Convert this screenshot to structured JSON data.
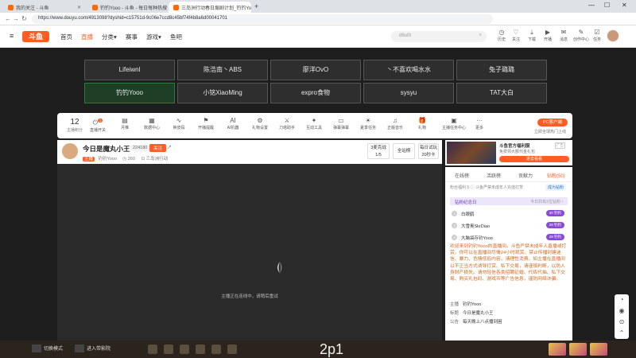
{
  "browser": {
    "tabs": [
      {
        "label": "我的关注 - 斗鱼"
      },
      {
        "label": "钓钓Yooo - 斗鱼 - 每日每种热搜"
      },
      {
        "label": "三岛洲行动春日煽剧计划_钓钓Yo"
      }
    ],
    "new_tab": "+",
    "win_min": "—",
    "win_max": "☐",
    "win_close": "✕",
    "back": "←",
    "forward": "→",
    "reload": "↻",
    "url": "https://www.douyu.com/4913098?dyshid=c15751d-9c06e7ccd8c45bf74f4b8a6d00041701"
  },
  "header": {
    "menu_icon": "≡",
    "logo": "斗鱼",
    "nav": [
      "首页",
      "直播",
      "分类",
      "赛事",
      "游戏",
      "鱼吧"
    ],
    "search_placeholder": "d8u0t",
    "icons": [
      {
        "label": "历史",
        "glyph": "◷"
      },
      {
        "label": "关注",
        "glyph": "♡"
      },
      {
        "label": "下载",
        "glyph": "⤓"
      },
      {
        "label": "开播",
        "glyph": "▶"
      },
      {
        "label": "消息",
        "glyph": "✉"
      },
      {
        "label": "创作中心",
        "glyph": "✎"
      },
      {
        "label": "任务",
        "glyph": "☑"
      }
    ]
  },
  "grid": {
    "row1": [
      "Lifeiwnl",
      "陈浩南丶ABS",
      "廖洋OvO",
      "丶不喜欢喝水水",
      "兔子璐璐"
    ],
    "row2": [
      "钓钓Yooo",
      "小铭XiaoMing",
      "expro食物",
      "sysyu",
      "TAT大白"
    ]
  },
  "toolbar": {
    "level_num": "12",
    "level_label": "主播积分",
    "tools": [
      {
        "label": "直播开关",
        "glyph": "⏻",
        "badge": "1"
      },
      {
        "label": "月推",
        "glyph": "▤"
      },
      {
        "label": "数据中心",
        "glyph": "▦"
      },
      {
        "label": "换皮码",
        "glyph": "∿"
      },
      {
        "label": "开播提醒",
        "glyph": "⚑"
      },
      {
        "label": "AI机器",
        "glyph": "AI"
      },
      {
        "label": "礼物设置",
        "glyph": "⚙"
      },
      {
        "label": "刀塔助手",
        "glyph": "⚔"
      },
      {
        "label": "互动工具",
        "glyph": "✦"
      },
      {
        "label": "弹幕弹幕",
        "glyph": "▭"
      },
      {
        "label": "夏季任务",
        "glyph": "☀"
      },
      {
        "label": "正版音乐",
        "glyph": "♫"
      },
      {
        "label": "礼物",
        "glyph": "🎁"
      },
      {
        "label": "主播任务中心",
        "glyph": "▣"
      },
      {
        "label": "更多",
        "glyph": "···"
      }
    ],
    "pc_label": "PC客户端",
    "pc_sub": "立即全球热门上线"
  },
  "streamer": {
    "title": "今日是魔丸小王",
    "follow_count": "224180",
    "follow_label": "关注",
    "share": "↗",
    "level_badge": "主播",
    "name": "钓钓Yooo",
    "online": "◷ 260",
    "category": "⊡ 三岛洲行动",
    "box1_top": "3麦克战",
    "box1_bottom": "1/5",
    "box2": "全站榜",
    "box3_top": "每日试玩",
    "box3_bottom": "20秒卡"
  },
  "video": {
    "status": "主播正在连线中，请稍后重试"
  },
  "ad": {
    "title": "斗鱼官方福利服",
    "sub": "免费领大额代金礼包",
    "button": "进去看看",
    "tag": "广告"
  },
  "panel": {
    "tabs": [
      "在线榜",
      "活跃榜",
      "贡献力",
      "钻粉(50)"
    ],
    "active_tab": 3,
    "row2": "粉丝福利 5 ⓘ 斗鱼严禁未成年人充值打赏",
    "row2_btn": "成为钻粉",
    "fan_header": "钻粉纪念日",
    "fan_header_right": "今日共有2位钻粉 ›",
    "fans": [
      {
        "rank": "1",
        "name": "白眼鹤",
        "badge": "30 钓钓"
      },
      {
        "rank": "2",
        "name": "大雪奥SkrDiao",
        "badge": "28 钓钓"
      },
      {
        "rank": "3",
        "name": "大脑袋存钓Yooo",
        "badge": "28 钓钓"
      }
    ],
    "notice": "欢迎来到钓钓Yooo的直播间。斗鱼严禁未成年人直播或打赏，你可以在直播间尽情24小时观赏。禁止传播封建迷信、暴力、色情低俗内容，请理性消费。如主播在直播间以不正当方式诱导打赏、私下交易，请谨慎判断，以防人身财产损失。请勿轻信各类招聘征婚、代练代抽、私下交易、购买礼包码、游戏币等广告信息，谨防网络诈骗。",
    "meta": [
      {
        "k": "主播",
        "v": "钓钓Yooo"
      },
      {
        "k": "标题",
        "v": "今日是魔丸小王"
      },
      {
        "k": "公告",
        "v": "每天晚上八点播到困"
      }
    ]
  },
  "sidefloat": [
    "◔",
    "◉",
    "⊙",
    "⌃"
  ],
  "taskbar": {
    "item1": "切换模式",
    "item2": "进入带影院",
    "big": "2p1"
  }
}
